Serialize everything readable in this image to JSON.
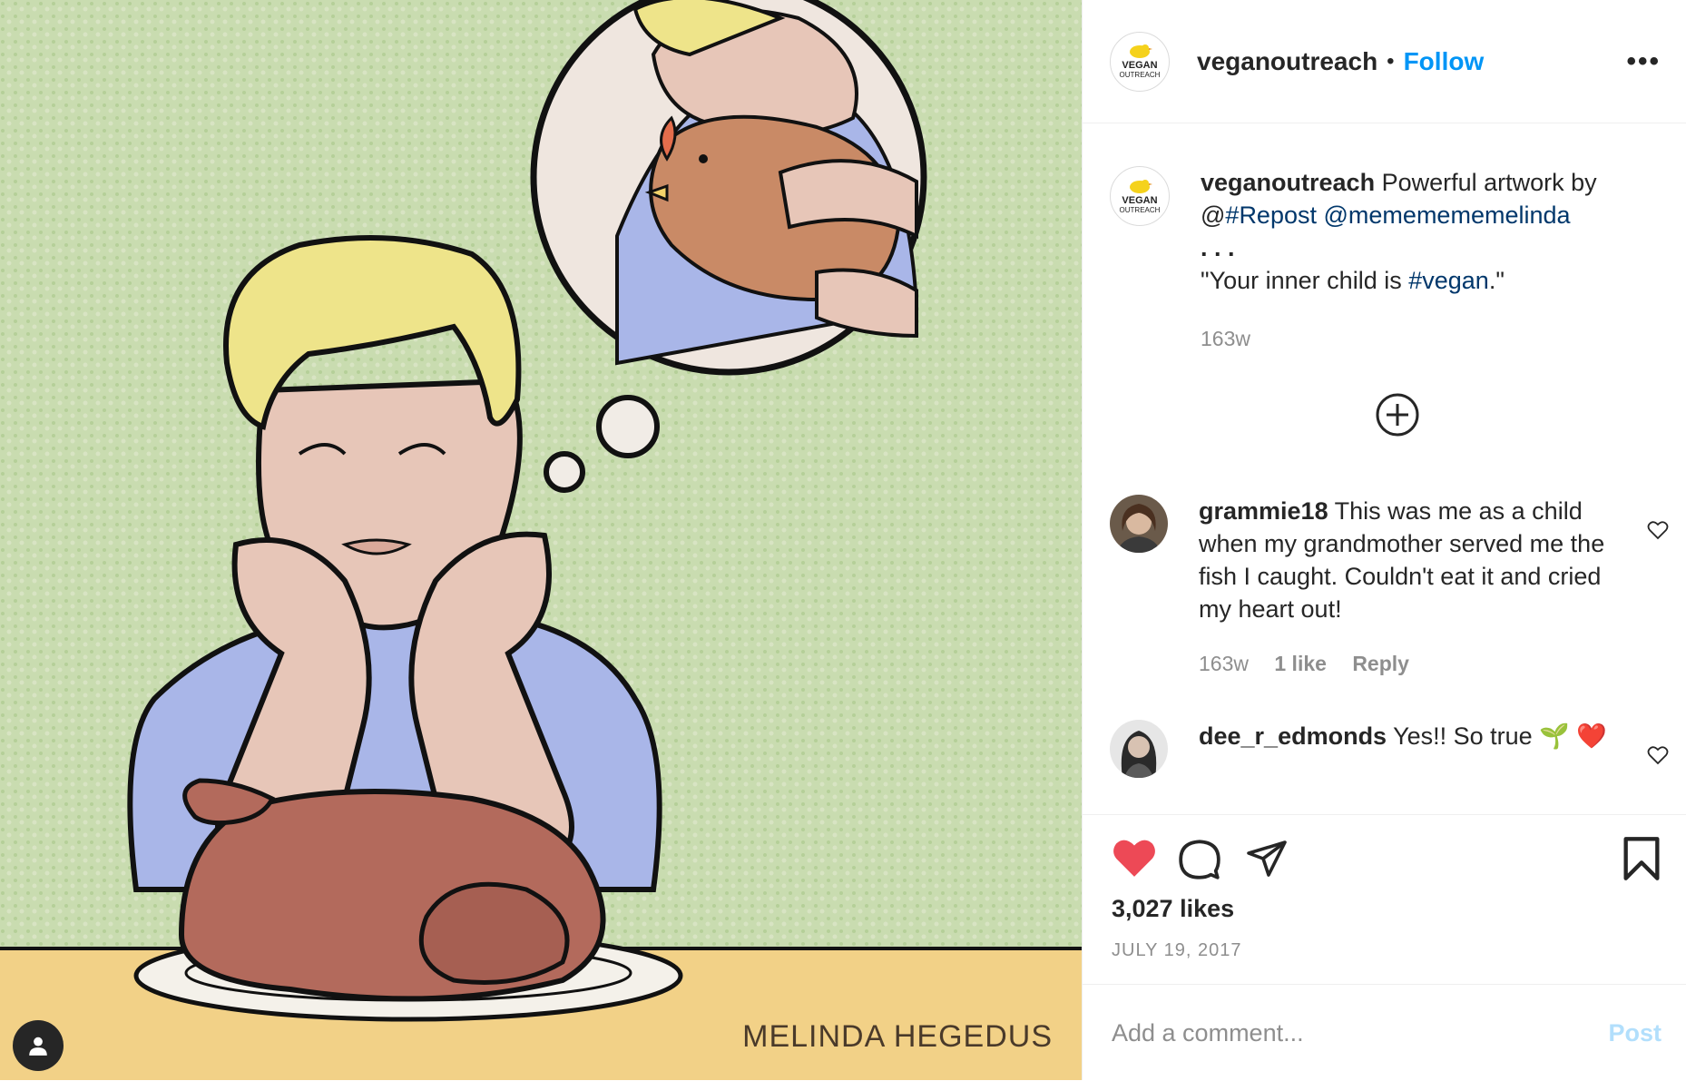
{
  "post": {
    "artist_credit": "MELINDA HEGEDUS"
  },
  "header": {
    "username": "veganoutreach",
    "separator": "•",
    "follow_label": "Follow",
    "more_label": "•••",
    "avatar_text_1": "VEGAN",
    "avatar_text_2": "OUTREACH"
  },
  "caption": {
    "username": "veganoutreach",
    "text_1": "Powerful artwork by",
    "at": "@",
    "link_1": "#Repost",
    "link_2": "@mememememelinda",
    "dots": ".   .   .",
    "quote_start": "\"Your inner child is ",
    "hashtag": "#vegan",
    "quote_end": ".\"",
    "time": "163w"
  },
  "comments": [
    {
      "username": "grammie18",
      "text": "This was me as a child when my grandmother served me the fish I caught. Couldn't eat it and cried my heart out!",
      "time": "163w",
      "likes": "1 like",
      "reply": "Reply"
    },
    {
      "username": "dee_r_edmonds",
      "text": "Yes!! So true 🌱 ❤️"
    }
  ],
  "actions": {
    "likes": "3,027 likes",
    "date": "JULY 19, 2017"
  },
  "add_comment": {
    "placeholder": "Add a comment...",
    "post_label": "Post"
  },
  "colors": {
    "follow": "#0095f6",
    "liked_heart": "#ed4956",
    "link": "#00376b",
    "muted": "#8e8e8e"
  }
}
